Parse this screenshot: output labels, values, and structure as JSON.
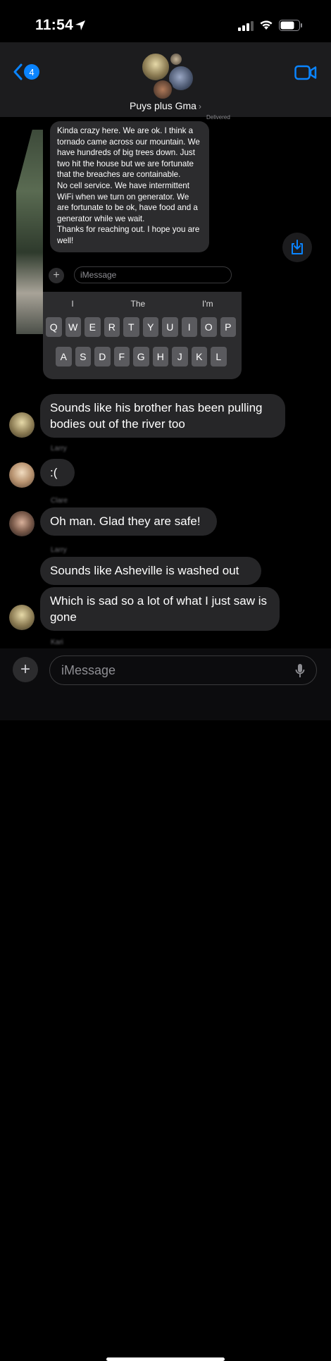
{
  "status": {
    "time": "11:54"
  },
  "header": {
    "back_count": "4",
    "group_name": "Puys plus Gma",
    "chevron": "›"
  },
  "screenshot": {
    "delivered": "Delivered",
    "message": "Kinda crazy here. We are ok. I think a tornado came across our mountain. We have hundreds of big trees down. Just two hit the house but we are fortunate that the breaches are containable.\nNo cell service. We have intermittent WiFi when we turn on generator. We are fortunate to be ok, have food and a generator while we wait.\nThanks for reaching out. I hope you are well!",
    "input_placeholder": "iMessage",
    "suggestions": [
      "I",
      "The",
      "I'm"
    ],
    "row1": [
      "Q",
      "W",
      "E",
      "R",
      "T",
      "Y",
      "U",
      "I",
      "O",
      "P"
    ],
    "row2": [
      "A",
      "S",
      "D",
      "F",
      "G",
      "H",
      "J",
      "K",
      "L"
    ]
  },
  "messages": [
    {
      "text": "Sounds like his brother has been pulling bodies out of the river too"
    },
    {
      "text": ":("
    },
    {
      "text": "Oh man. Glad they are safe!"
    },
    {
      "text": "Sounds like Asheville is washed out"
    },
    {
      "text": "Which is sad so a lot of what I just saw is gone"
    }
  ],
  "senders": [
    "Larry",
    "Clare",
    "Larry",
    "Kari"
  ],
  "composer": {
    "placeholder": "iMessage",
    "plus": "+"
  },
  "colors": {
    "accent": "#0a84ff",
    "bubble": "#262628",
    "background": "#000000"
  }
}
